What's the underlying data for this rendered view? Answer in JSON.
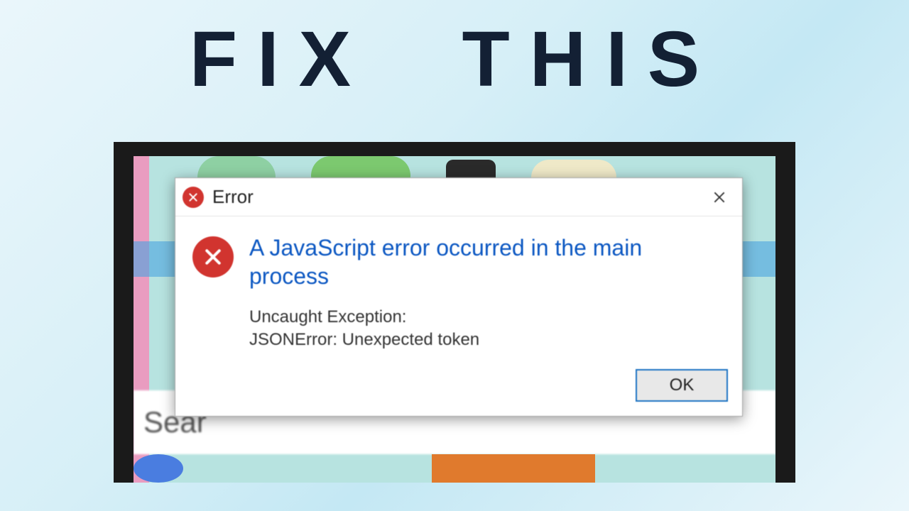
{
  "headline": "FIX THIS",
  "background": {
    "search_placeholder": "Sear"
  },
  "dialog": {
    "title": "Error",
    "heading": "A JavaScript error occurred in the main process",
    "detail": "Uncaught Exception:\nJSONError: Unexpected token",
    "ok_label": "OK"
  }
}
